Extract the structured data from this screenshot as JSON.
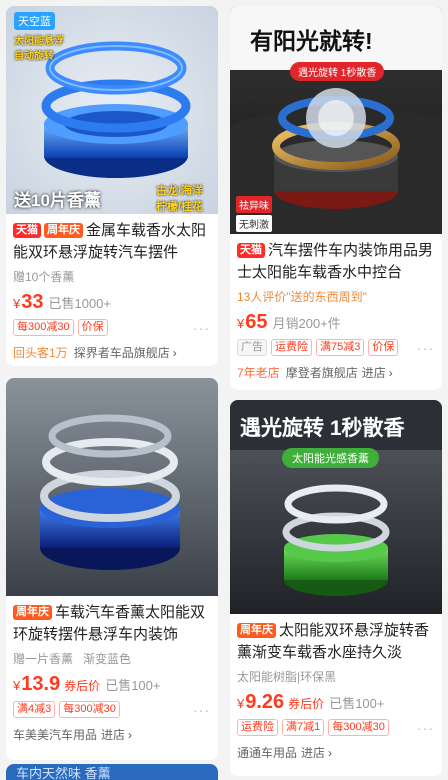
{
  "products": [
    {
      "image": {
        "variant_tag": "天空蓝",
        "feature_line1": "太阳能悬浮",
        "feature_line2": "自动旋转",
        "promo": "送10片香薰",
        "scent_line1": "古龙/海洋",
        "scent_line2": "柠檬/桂花"
      },
      "tags": [
        "天猫",
        "周年庆"
      ],
      "title": "金属车载香水太阳能双环悬浮旋转汽车摆件",
      "subtitle": "赠10个香薰",
      "price_symbol": "¥",
      "price": "33",
      "sales": "已售1000+",
      "badges": [
        "每300减30",
        "价保"
      ],
      "reputation": "回头客1万",
      "shop_name": "探界者车品旗舰店",
      "more": "···"
    },
    {
      "image": {
        "headline": "有阳光就转!",
        "sub_banner": "遇光旋转 1秒散香",
        "stamp1": "祛异味",
        "stamp2": "无刺激"
      },
      "tags": [
        "天猫"
      ],
      "title": "汽车摆件车内装饰用品男士太阳能车载香水中控台",
      "subtitle": "13人评价\"送的东西周到\"",
      "price_symbol": "¥",
      "price": "65",
      "sales": "月销200+件",
      "badges": [
        "广告",
        "运费险",
        "满75减3",
        "价保"
      ],
      "reputation": "7年老店",
      "shop_name": "摩登者旗舰店",
      "shop_action": "进店",
      "more": "···"
    },
    {
      "tags": [
        "周年庆"
      ],
      "title": "车载汽车香薰太阳能双环旋转摆件悬浮车内装饰",
      "subtitle": "赠一片香薰   渐变蓝色",
      "price_symbol": "¥",
      "price": "13.9",
      "after_label": "券后价",
      "sales": "已售100+",
      "badges": [
        "满4减3",
        "每300减30"
      ],
      "shop_name": "车美美汽车用品",
      "shop_action": "进店",
      "more": "···"
    },
    {
      "image": {
        "headline": "遇光旋转 1秒散香",
        "sub_banner": "太阳能光感香薰"
      },
      "tags": [
        "周年庆"
      ],
      "title": "太阳能双环悬浮旋转香薰渐变车载香水座持久淡",
      "subtitle": "太阳能树脂|环保黑",
      "price_symbol": "¥",
      "price": "9.26",
      "after_label": "券后价",
      "sales": "已售100+",
      "badges": [
        "运费险",
        "满7减1",
        "每300减30"
      ],
      "shop_name": "通通车用品",
      "shop_action": "进店",
      "more": "···"
    }
  ],
  "next_card_peek": "车内天然味 香薰"
}
